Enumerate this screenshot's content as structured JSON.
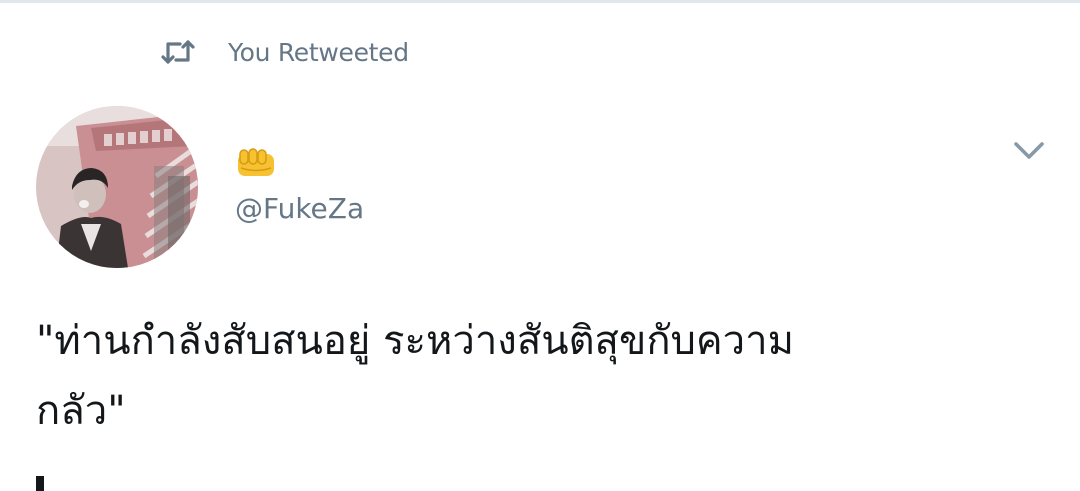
{
  "retweet": {
    "icon": "retweet-icon",
    "label": "You Retweeted"
  },
  "author": {
    "avatar": "avatar",
    "display_name_emoji": "fist-emoji",
    "handle": "@FukeZa"
  },
  "tweet": {
    "text": "\"ท่านกำลังสับสนอยู่ ระหว่างสันติสุขกับความ\nกลัว\""
  },
  "menu": {
    "icon": "chevron-down-icon"
  },
  "colors": {
    "secondary_text": "#657786",
    "primary_text": "#14171a",
    "emoji_yellow": "#f7c231"
  }
}
